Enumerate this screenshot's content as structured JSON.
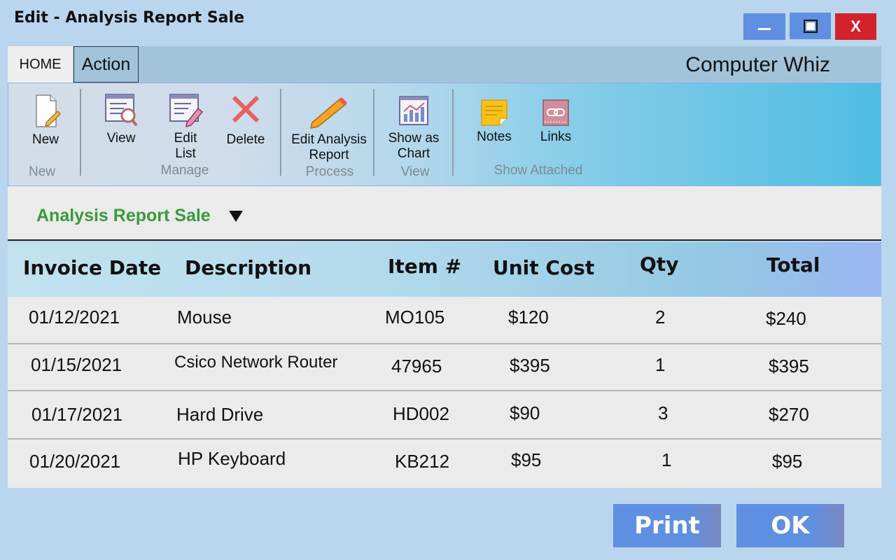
{
  "window": {
    "title": "Edit - Analysis Report Sale",
    "minimize_label": "—",
    "close_label": "X"
  },
  "tabs": {
    "home": "HOME",
    "action": "Action"
  },
  "company": "Computer Whiz",
  "ribbon": {
    "new": {
      "label": "New",
      "group": "New"
    },
    "manage": {
      "view": "View",
      "edit_list": "Edit List",
      "delete": "Delete",
      "group": "Manage"
    },
    "process": {
      "edit_analysis_report": "Edit Analysis Report",
      "group": "Process"
    },
    "view": {
      "show_as_chart": "Show as Chart",
      "group": "View"
    },
    "show_attached": {
      "notes": "Notes",
      "links": "Links",
      "group": "Show Attached"
    }
  },
  "report_selector": {
    "selected": "Analysis Report Sale"
  },
  "table": {
    "columns": [
      "Invoice Date",
      "Description",
      "Item #",
      "Unit Cost",
      "Qty",
      "Total"
    ],
    "rows": [
      [
        "01/12/2021",
        "Mouse",
        "MO105",
        "$120",
        "2",
        "$240"
      ],
      [
        "01/15/2021",
        "Csico Network Router",
        "47965",
        "$395",
        "1",
        "$395"
      ],
      [
        "01/17/2021",
        "Hard Drive",
        "HD002",
        "$90",
        "3",
        "$270"
      ],
      [
        "01/20/2021",
        "HP Keyboard",
        "KB212",
        "$95",
        "1",
        "$95"
      ]
    ]
  },
  "buttons": {
    "print": "Print",
    "ok": "OK"
  },
  "colors": {
    "accent_blue": "#5f8fe0",
    "close_red": "#d3222a",
    "report_green": "#3a9a3a"
  }
}
